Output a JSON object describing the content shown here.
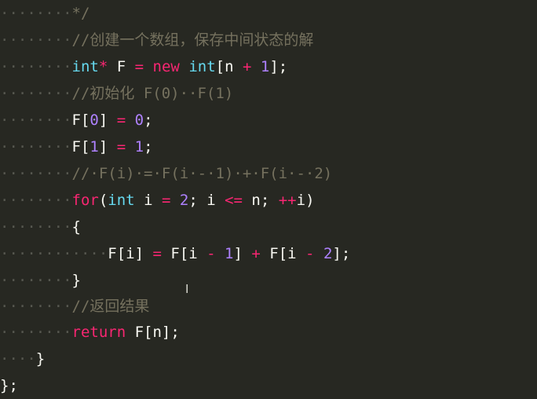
{
  "colors": {
    "background": "#272822",
    "whitespace_dots": "#56574f",
    "keyword": "#f92672",
    "type": "#66d9ef",
    "number": "#ae81ff",
    "comment": "#75715e",
    "text": "#f8f8f2"
  },
  "lines": [
    {
      "tokens": [
        {
          "t": "········",
          "c": "ws"
        },
        {
          "t": "*/",
          "c": "comment"
        }
      ]
    },
    {
      "tokens": [
        {
          "t": "········",
          "c": "ws"
        },
        {
          "t": "//创建一个数组，保存中间状态的解",
          "c": "comment"
        }
      ]
    },
    {
      "tokens": [
        {
          "t": "········",
          "c": "ws"
        },
        {
          "t": "int",
          "c": "type"
        },
        {
          "t": "*",
          "c": "keyword"
        },
        {
          "t": " F ",
          "c": "text"
        },
        {
          "t": "=",
          "c": "keyword"
        },
        {
          "t": " ",
          "c": "text"
        },
        {
          "t": "new",
          "c": "keyword"
        },
        {
          "t": " ",
          "c": "text"
        },
        {
          "t": "int",
          "c": "type"
        },
        {
          "t": "[n ",
          "c": "text"
        },
        {
          "t": "+",
          "c": "keyword"
        },
        {
          "t": " ",
          "c": "text"
        },
        {
          "t": "1",
          "c": "number"
        },
        {
          "t": "];",
          "c": "text"
        }
      ]
    },
    {
      "tokens": [
        {
          "t": "········",
          "c": "ws"
        },
        {
          "t": "//初始化 F(0)··F(1)",
          "c": "comment"
        }
      ]
    },
    {
      "tokens": [
        {
          "t": "········",
          "c": "ws"
        },
        {
          "t": "F[",
          "c": "text"
        },
        {
          "t": "0",
          "c": "number"
        },
        {
          "t": "] ",
          "c": "text"
        },
        {
          "t": "=",
          "c": "keyword"
        },
        {
          "t": " ",
          "c": "text"
        },
        {
          "t": "0",
          "c": "number"
        },
        {
          "t": ";",
          "c": "text"
        }
      ]
    },
    {
      "tokens": [
        {
          "t": "········",
          "c": "ws"
        },
        {
          "t": "F[",
          "c": "text"
        },
        {
          "t": "1",
          "c": "number"
        },
        {
          "t": "] ",
          "c": "text"
        },
        {
          "t": "=",
          "c": "keyword"
        },
        {
          "t": " ",
          "c": "text"
        },
        {
          "t": "1",
          "c": "number"
        },
        {
          "t": ";",
          "c": "text"
        }
      ]
    },
    {
      "tokens": [
        {
          "t": "········",
          "c": "ws"
        },
        {
          "t": "//·F(i)·=·F(i·-·1)·+·F(i·-·2)",
          "c": "comment"
        }
      ]
    },
    {
      "tokens": [
        {
          "t": "········",
          "c": "ws"
        },
        {
          "t": "for",
          "c": "keyword"
        },
        {
          "t": "(",
          "c": "text"
        },
        {
          "t": "int",
          "c": "type"
        },
        {
          "t": " i ",
          "c": "text"
        },
        {
          "t": "=",
          "c": "keyword"
        },
        {
          "t": " ",
          "c": "text"
        },
        {
          "t": "2",
          "c": "number"
        },
        {
          "t": "; i ",
          "c": "text"
        },
        {
          "t": "<=",
          "c": "keyword"
        },
        {
          "t": " n; ",
          "c": "text"
        },
        {
          "t": "++",
          "c": "keyword"
        },
        {
          "t": "i)",
          "c": "text"
        }
      ]
    },
    {
      "tokens": [
        {
          "t": "········",
          "c": "ws"
        },
        {
          "t": "{",
          "c": "text"
        }
      ]
    },
    {
      "tokens": [
        {
          "t": "············",
          "c": "ws"
        },
        {
          "t": "F[i] ",
          "c": "text"
        },
        {
          "t": "=",
          "c": "keyword"
        },
        {
          "t": " F[i ",
          "c": "text"
        },
        {
          "t": "-",
          "c": "keyword"
        },
        {
          "t": " ",
          "c": "text"
        },
        {
          "t": "1",
          "c": "number"
        },
        {
          "t": "] ",
          "c": "text"
        },
        {
          "t": "+",
          "c": "keyword"
        },
        {
          "t": " F[i ",
          "c": "text"
        },
        {
          "t": "-",
          "c": "keyword"
        },
        {
          "t": " ",
          "c": "text"
        },
        {
          "t": "2",
          "c": "number"
        },
        {
          "t": "];",
          "c": "text"
        }
      ]
    },
    {
      "tokens": [
        {
          "t": "········",
          "c": "ws"
        },
        {
          "t": "}",
          "c": "text"
        }
      ]
    },
    {
      "tokens": [
        {
          "t": "········",
          "c": "ws"
        },
        {
          "t": "//返回结果",
          "c": "comment"
        }
      ]
    },
    {
      "tokens": [
        {
          "t": "········",
          "c": "ws"
        },
        {
          "t": "return",
          "c": "keyword"
        },
        {
          "t": " F[n];",
          "c": "text"
        }
      ]
    },
    {
      "tokens": [
        {
          "t": "····",
          "c": "ws"
        },
        {
          "t": "}",
          "c": "text"
        }
      ]
    },
    {
      "tokens": [
        {
          "t": "};",
          "c": "text"
        }
      ]
    }
  ]
}
